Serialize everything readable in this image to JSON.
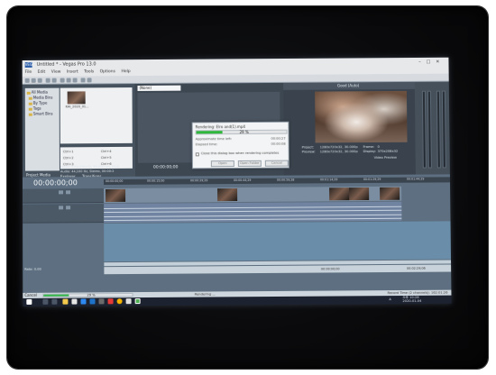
{
  "window": {
    "title": "Untitled * - Vegas Pro 13.0",
    "app_badge": "VEG"
  },
  "menu": [
    "File",
    "Edit",
    "View",
    "Insert",
    "Tools",
    "Options",
    "Help"
  ],
  "explorer": {
    "tree_items": [
      "All Media",
      "Media Bins",
      "By Type",
      "Tags",
      "Smart Bins"
    ],
    "media_file": "KAI_2020_01...",
    "shortcuts": [
      {
        "key": "Ctrl+1",
        "alt": "Ctrl+4"
      },
      {
        "key": "Ctrl+2",
        "alt": "Ctrl+5"
      },
      {
        "key": "Ctrl+3",
        "alt": "Ctrl+6"
      }
    ],
    "video_info": "Video: 576x576x32, 30.000 fps, 00:0",
    "audio_info": "Audio: 44,100 Hz, Stereo, 00:00:2",
    "tabs": [
      "Project Media",
      "Explorer",
      "Transitions"
    ]
  },
  "trimmer": {
    "preset": "(None)",
    "timecode": "00:00:00;00"
  },
  "render_dialog": {
    "title": "Rendering: Elro and(1).mp4",
    "percent_label": "29 %",
    "progress": 0.29,
    "approx_label": "Approximate time left:",
    "approx_value": "00:00:27",
    "elapsed_label": "Elapsed time:",
    "elapsed_value": "00:00:08",
    "checkbox_label": "Close this dialog box when rendering completes",
    "buttons": [
      "Open",
      "Open Folder",
      "Cancel"
    ]
  },
  "preview": {
    "quality": "Good (Auto)",
    "project_label": "Project:",
    "project_value": "1280x720x32, 30.000p",
    "preview_label": "Preview:",
    "preview_value": "1280x720x32, 30.000p",
    "frame_label": "Frame:",
    "frame_value": "0",
    "display_label": "Display:",
    "display_value": "370x208x32",
    "video_preview_tab": "Video Preview"
  },
  "timeline": {
    "timecode": "00:00:00;00",
    "ruler_ticks": [
      "00:00:00;00",
      "00:00:15;00",
      "00:00:29;29",
      "00:00:44;29",
      "00:00:59;28",
      "00:01:14;29",
      "00:01:29;29",
      "00:01:44;29"
    ],
    "rate": "Rate: 0.00",
    "time_left": "00:00:00;00",
    "time_right": "00:02:29;06"
  },
  "status_bar": {
    "cancel": "Cancel",
    "percent": "29 %",
    "progress": 0.29,
    "rendering": "Rendering ...",
    "record_time": "Record Time (2 channels): 162:01:26"
  },
  "taskbar": {
    "lang": "A",
    "time": "오후 10:28",
    "date": "2020-01-04"
  }
}
